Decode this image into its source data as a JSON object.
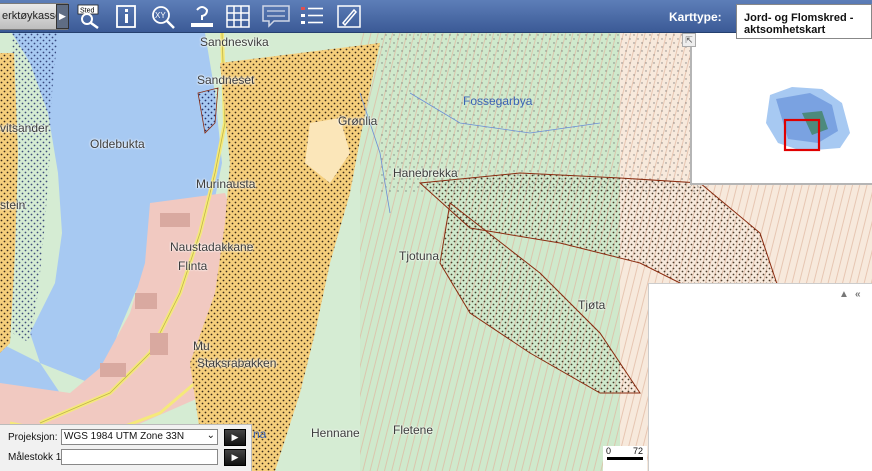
{
  "toolbar": {
    "toolbox_label": "erktøykasse",
    "toolbox_arrow": "▶",
    "tools": [
      {
        "name": "sted-search-tool",
        "badge": "Sted",
        "icon": "magnifier-icon"
      },
      {
        "name": "info-tool",
        "badge": "",
        "icon": "info-icon"
      },
      {
        "name": "xy-search-tool",
        "badge": "XY",
        "icon": "xy-magnifier-icon"
      },
      {
        "name": "help-tool",
        "badge": "",
        "icon": "question-icon"
      },
      {
        "name": "grid-tool",
        "badge": "",
        "icon": "grid-icon"
      },
      {
        "name": "comment-tool",
        "badge": "",
        "icon": "speech-bubble-icon"
      },
      {
        "name": "legend-tool",
        "badge": "",
        "icon": "legend-list-icon"
      },
      {
        "name": "draw-tool",
        "badge": "",
        "icon": "pencil-icon"
      }
    ],
    "karttype_label": "Karttype:",
    "karttype_value": "Jord- og Flomskred - aktsomhetskart"
  },
  "map": {
    "places": [
      {
        "id": "sandnesvika",
        "text": "Sandnesvika",
        "color": "dark"
      },
      {
        "id": "sandneset",
        "text": "Sandneset",
        "color": "dark"
      },
      {
        "id": "fossegarbya",
        "text": "Fossegarbya",
        "color": "blue"
      },
      {
        "id": "gronlia",
        "text": "Grønlia",
        "color": "dark"
      },
      {
        "id": "oldebukta",
        "text": "Oldebukta",
        "color": "dark"
      },
      {
        "id": "vitsander",
        "text": "vitsander",
        "color": "dark"
      },
      {
        "id": "murinausta",
        "text": "Murinausta",
        "color": "dark"
      },
      {
        "id": "hanebrekka",
        "text": "Hanebrekka",
        "color": "dark"
      },
      {
        "id": "stein",
        "text": "stein",
        "color": "dark"
      },
      {
        "id": "naustadakkane",
        "text": "Naustadakkane",
        "color": "dark"
      },
      {
        "id": "flinta",
        "text": "Flinta",
        "color": "dark"
      },
      {
        "id": "tjotuna",
        "text": "Tjotuna",
        "color": "dark"
      },
      {
        "id": "tjota",
        "text": "Tjøta",
        "color": "dark"
      },
      {
        "id": "mu",
        "text": "Mu",
        "color": "dark"
      },
      {
        "id": "staksrabakken",
        "text": "Staksrabakken",
        "color": "dark"
      },
      {
        "id": "na",
        "text": "na",
        "color": "blue"
      },
      {
        "id": "hennane",
        "text": "Hennane",
        "color": "dark"
      },
      {
        "id": "fletene",
        "text": "Fletene",
        "color": "dark"
      }
    ]
  },
  "overview": {
    "expand_icon": "⇱"
  },
  "panel": {
    "collapse_icon": "▲",
    "back_icon": "«"
  },
  "controls": {
    "projection_label": "Projeksjon:",
    "projection_value": "WGS 1984 UTM Zone 33N",
    "scale_label": "Målestokk 1:",
    "scale_value": "",
    "go_icon": "▶"
  },
  "scalebar": {
    "start": "0",
    "end": "72"
  },
  "colors": {
    "water": "#a7c9f2",
    "hazard_orange": "#f6cf7c",
    "green_zone": "#cfe9cc",
    "urban": "#f1c9c1",
    "toolbar": "#3b5a96"
  }
}
